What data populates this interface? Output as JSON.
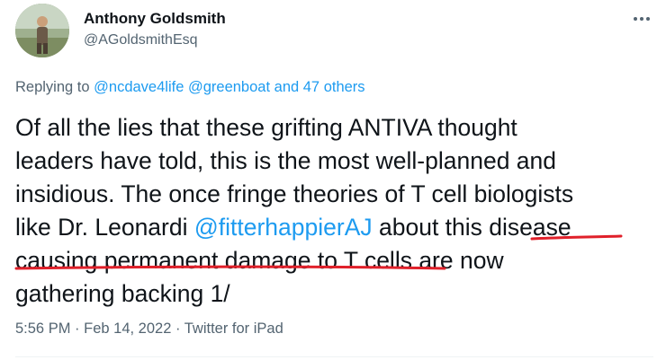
{
  "author": {
    "name": "Anthony Goldsmith",
    "handle": "@AGoldsmithEsq",
    "avatar_icon": "profile-photo"
  },
  "more_icon": "more-dots-icon",
  "replying": {
    "prefix": "Replying to ",
    "mention1": "@ncdave4life",
    "mention2": "@greenboat",
    "others": "and 47 others"
  },
  "tweet": {
    "line1": "Of all the lies that these grifting ANTIVA thought",
    "line2": "leaders have told, this is the most well-planned and",
    "line3": "insidious. The once fringe theories of T cell biologists",
    "line4_a": "like Dr. Leonardi ",
    "line4_mention": "@fitterhappierAJ",
    "line4_b": " about this disease",
    "line5": "causing permanent damage to T cells are now",
    "line6": "gathering backing 1/"
  },
  "meta": {
    "time": "5:56 PM",
    "separator": " · ",
    "date": "Feb 14, 2022",
    "source": "Twitter for iPad"
  },
  "colors": {
    "link": "#1d9bf0",
    "text": "#0f1419",
    "secondary": "#536471",
    "annotation": "#e0202a"
  }
}
